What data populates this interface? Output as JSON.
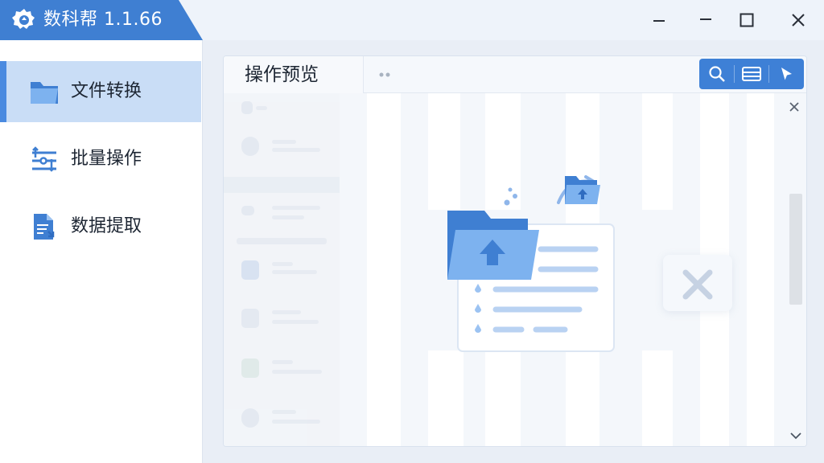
{
  "app": {
    "name": "数科帮",
    "version": "1.1.66",
    "accent": "#3f7fd2",
    "icons": {
      "logo": "gear-logo-icon",
      "minimize": "minimize-icon",
      "maximize": "maximize-icon",
      "close": "close-icon"
    }
  },
  "sidebar": {
    "items": [
      {
        "label": "文件转换",
        "icon": "folder-icon",
        "active": true
      },
      {
        "label": "批量操作",
        "icon": "batch-sliders-icon",
        "active": false
      },
      {
        "label": "数据提取",
        "icon": "document-extract-icon",
        "active": false
      }
    ]
  },
  "main": {
    "tab_label": "操作预览",
    "toolbar": {
      "icons": [
        "search-icon",
        "scan-icon",
        "pointer-icon"
      ]
    },
    "illustration": {
      "icons": [
        "folder-upload-icon",
        "small-folder-upload-icon",
        "cancel-x-icon"
      ]
    }
  }
}
